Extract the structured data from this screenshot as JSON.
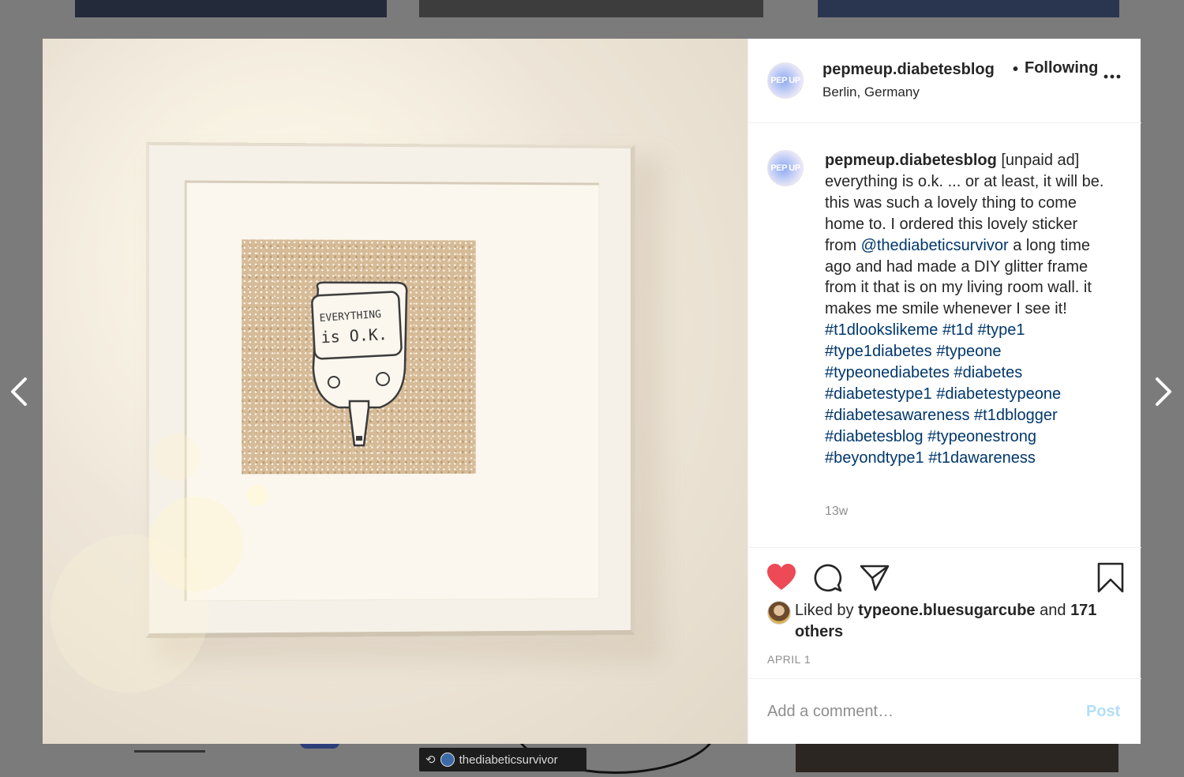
{
  "background": {
    "bottom_tag": "thediabeticsurvivor"
  },
  "photo": {
    "sticker_line1": "EVERYTHING",
    "sticker_line2": "is O.K."
  },
  "header": {
    "username": "pepmeup.diabetesblog",
    "separator": "•",
    "follow_status": "Following",
    "location": "Berlin, Germany"
  },
  "caption": {
    "username": "pepmeup.diabetesblog",
    "text_part1": "[unpaid ad] everything is o.k. ... or at least, it will be. this was such a lovely thing to come home to. I ordered this lovely sticker from",
    "mention": "@thediabeticsurvivor",
    "text_part2": "a long time ago and had made a DIY glitter frame from it that is on my living room wall. it makes me smile whenever I see it!",
    "hashtags": [
      "#t1dlookslikeme",
      "#t1d",
      "#type1",
      "#type1diabetes",
      "#typeone",
      "#typeonediabetes",
      "#diabetes",
      "#diabetestype1",
      "#diabetestypeone",
      "#diabetesawareness",
      "#t1dblogger",
      "#diabetesblog",
      "#typeonestrong",
      "#beyondtype1",
      "#t1dawareness"
    ],
    "time_ago": "13w"
  },
  "likes": {
    "prefix": "Liked by",
    "user": "typeone.bluesugarcube",
    "middle": "and",
    "others": "171 others"
  },
  "post_date": "APRIL 1",
  "comment_box": {
    "placeholder": "Add a comment…",
    "post_label": "Post"
  },
  "colors": {
    "heart": "#ed4956",
    "link": "#00376b",
    "post_button": "#b2dffc",
    "muted": "#8e8e8e"
  },
  "icons": [
    "chevron-left-icon",
    "chevron-right-icon",
    "more-icon",
    "heart-icon",
    "comment-icon",
    "share-icon",
    "bookmark-icon"
  ]
}
